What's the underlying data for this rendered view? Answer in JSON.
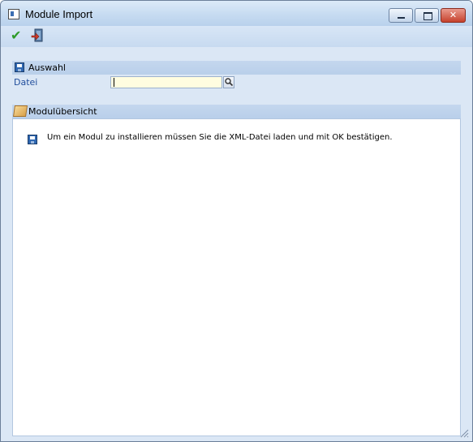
{
  "window": {
    "title": "Module Import",
    "controls": {
      "minimize": "minimize",
      "maximize": "maximize",
      "close": "✕"
    }
  },
  "toolbar": {
    "items": [
      {
        "name": "ok",
        "icon": "checkmark-icon"
      },
      {
        "name": "exit",
        "icon": "exit-door-icon"
      }
    ]
  },
  "sections": {
    "auswahl": {
      "label": "Auswahl",
      "icon": "floppy-disk-icon"
    },
    "moduluebersicht": {
      "label": "Modulübersicht",
      "icon": "package-box-icon"
    }
  },
  "form": {
    "datei_label": "Datei",
    "datei_value": "",
    "browse_icon": "magnifier-icon"
  },
  "content": {
    "info_icon": "floppy-disk-icon",
    "info_text": "Um ein Modul zu installieren müssen Sie die XML-Datei laden und mit OK bestätigen."
  },
  "colors": {
    "accent": "#214e9c",
    "panel_bg": "#dbe7f5",
    "input_bg": "#fffde0",
    "close_button": "#c6412c"
  }
}
